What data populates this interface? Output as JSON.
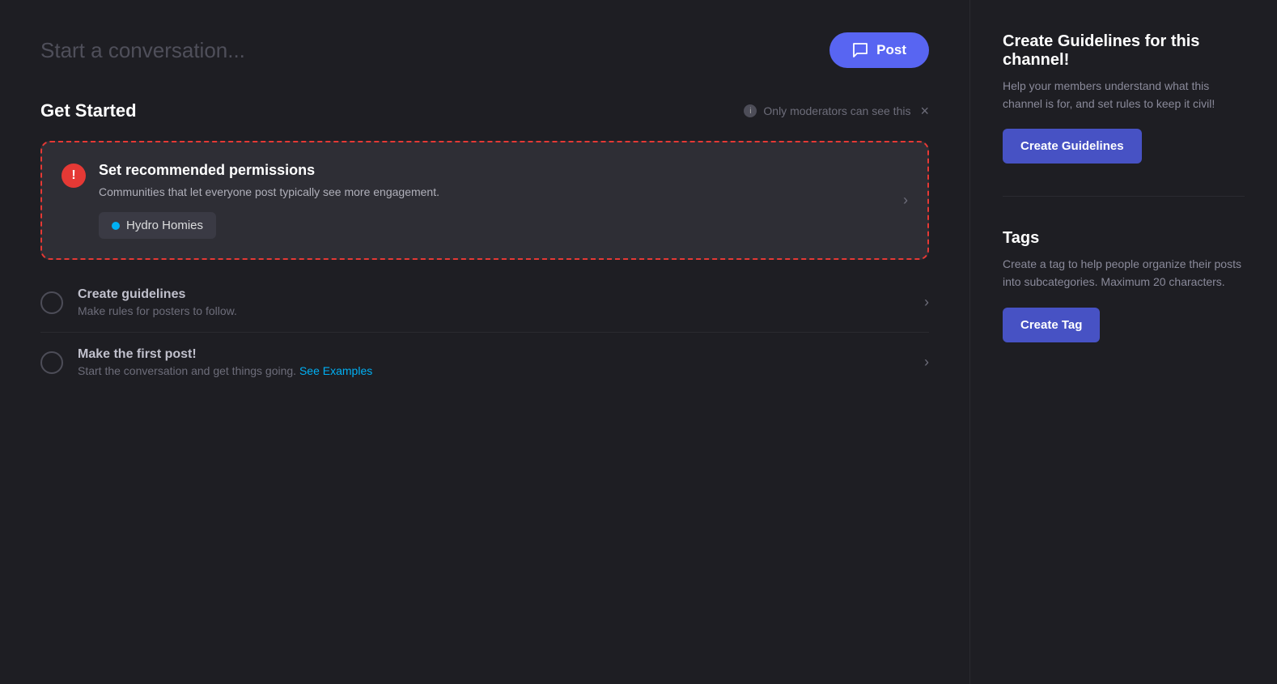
{
  "conversation": {
    "placeholder": "Start a conversation...",
    "post_button_label": "Post"
  },
  "get_started": {
    "title": "Get Started",
    "moderator_notice": "Only moderators can see this",
    "close_label": "×"
  },
  "permissions_card": {
    "title": "Set recommended permissions",
    "description": "Communities that let everyone post typically see more engagement.",
    "community_name": "Hydro Homies",
    "chevron": "›"
  },
  "list_items": [
    {
      "title": "Create guidelines",
      "description": "Make rules for posters to follow.",
      "link_text": null,
      "link_url": null
    },
    {
      "title": "Make the first post!",
      "description": "Start the conversation and get things going.",
      "link_text": "See Examples",
      "link_url": "#"
    }
  ],
  "right_sidebar": {
    "guidelines_section": {
      "title": "Create Guidelines for this channel!",
      "description": "Help your members understand what this channel is for, and set rules to keep it civil!",
      "button_label": "Create Guidelines"
    },
    "tags_section": {
      "title": "Tags",
      "description": "Create a tag to help people organize their posts into subcategories. Maximum 20 characters.",
      "button_label": "Create Tag"
    }
  },
  "icons": {
    "post_icon": "💬",
    "info_icon": "i",
    "error_icon": "!",
    "chevron": "›",
    "close": "×"
  }
}
